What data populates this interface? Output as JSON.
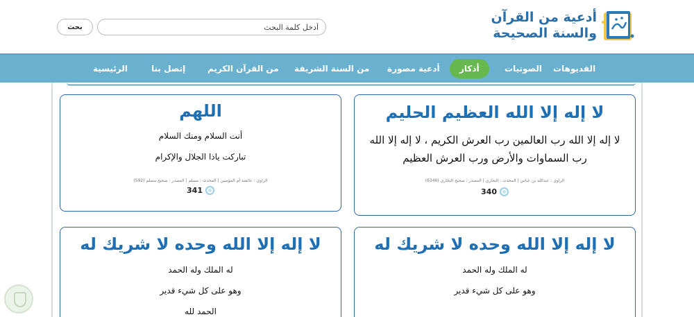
{
  "header": {
    "logo_line1": "أدعية من القرآن",
    "logo_line2": "والسنة الصحيحة",
    "logo_icon": "dua-book-logo"
  },
  "search": {
    "placeholder": "أدخل كلمة البحث",
    "button_label": "بحث"
  },
  "nav": {
    "items": [
      {
        "label": "الفديوهات"
      },
      {
        "label": "الصوتيات"
      },
      {
        "label": "أذكار",
        "active": true
      },
      {
        "label": "أدعية مصورة"
      },
      {
        "label": "من السنة الشريفة"
      },
      {
        "label": "من القرآن الكريم"
      },
      {
        "label": "إتصل بنا"
      },
      {
        "label": "الرئيسية"
      }
    ],
    "active_color": "#67b94f",
    "bar_color": "#6ab0cf"
  },
  "cards": [
    {
      "title": "لا إله إلا الله العظيم الحليم",
      "lines": [
        "لا إله إلا الله رب العالمين رب العرش الكريم ، لا إله إلا الله",
        "رب السماوات والأرض ورب العرش العظيم"
      ],
      "meta": "الراوي : عبدالله بن عباس | المحدث : البخاري | المصدر : صحيح البخاري (6346)",
      "count": "340"
    },
    {
      "title": "اللهم",
      "lines": [
        "أنت السلام ومنك السلام",
        "تباركت ياذا الجلال والإكرام"
      ],
      "meta": "الراوي : عائشة أم المؤمنين | المحدث : مسلم | المصدر : صحيح مسلم (592)",
      "count": "341"
    },
    {
      "title": "لا إله إلا الله وحده لا شريك له",
      "lines": [
        "له الملك وله الحمد",
        "وهو على كل شيء قدير"
      ]
    },
    {
      "title": "لا إله إلا الله وحده لا شريك له",
      "lines": [
        "له الملك وله الحمد",
        "وهو على كل شيء قدير",
        "الحمد لله"
      ]
    }
  ],
  "colors": {
    "accent": "#1f6fb4",
    "card_border": "#2c66b5"
  }
}
